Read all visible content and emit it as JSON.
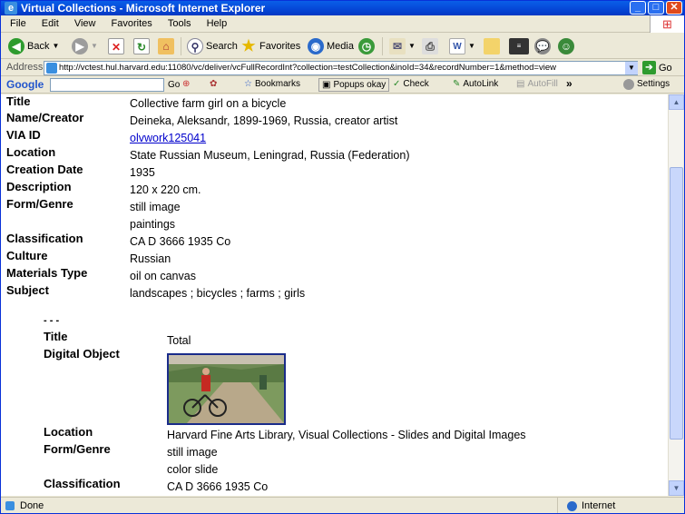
{
  "window": {
    "title": "Virtual Collections - Microsoft Internet Explorer"
  },
  "menu": [
    "File",
    "Edit",
    "View",
    "Favorites",
    "Tools",
    "Help"
  ],
  "toolbar": {
    "back": "Back",
    "search": "Search",
    "favorites": "Favorites",
    "media": "Media"
  },
  "address": {
    "label": "Address",
    "url": "http://vctest.hul.harvard.edu:11080/vc/deliver/vcFullRecordInt?collection=testCollection&inoId=34&recordNumber=1&method=view",
    "go": "Go"
  },
  "google": {
    "logo": "Google",
    "go": "Go",
    "bookmarks": "Bookmarks",
    "popups": "Popups okay",
    "check": "Check",
    "autolink": "AutoLink",
    "autofill": "AutoFill",
    "more": "»",
    "settings": "Settings"
  },
  "record": [
    {
      "label": "Title",
      "values": [
        "Collective farm girl on a bicycle"
      ]
    },
    {
      "label": "Name/Creator",
      "values": [
        "Deineka, Aleksandr, 1899-1969, Russia,  creator artist"
      ]
    },
    {
      "label": "VIA ID",
      "values": [
        "olvwork125041 "
      ],
      "link": true
    },
    {
      "label": "Location",
      "values": [
        "State Russian Museum, Leningrad, Russia (Federation)"
      ]
    },
    {
      "label": "Creation Date",
      "values": [
        "1935"
      ]
    },
    {
      "label": "Description",
      "values": [
        "120 x 220 cm."
      ]
    },
    {
      "label": "Form/Genre",
      "values": [
        "still image",
        "paintings"
      ]
    },
    {
      "label": "Classification",
      "values": [
        "CA D 3666 1935 Co"
      ]
    },
    {
      "label": "Culture",
      "values": [
        "Russian"
      ]
    },
    {
      "label": "Materials Type",
      "values": [
        "oil on canvas"
      ]
    },
    {
      "label": "Subject",
      "values": [
        "landscapes ;  bicycles ;  farms ;  girls"
      ]
    }
  ],
  "surrogate": {
    "separator": "- - -",
    "title_label": "Title",
    "title_value": "Total",
    "digital_object_label": "Digital Object",
    "location_label": "Location",
    "location_value": "Harvard Fine Arts Library, Visual Collections - Slides and Digital Images",
    "form_label": "Form/Genre",
    "form_values": [
      "still image",
      "color slide"
    ],
    "class_label": "Classification",
    "class_value": "CA D 3666 1935 Co"
  },
  "status": {
    "left": "Done",
    "right": "Internet"
  }
}
